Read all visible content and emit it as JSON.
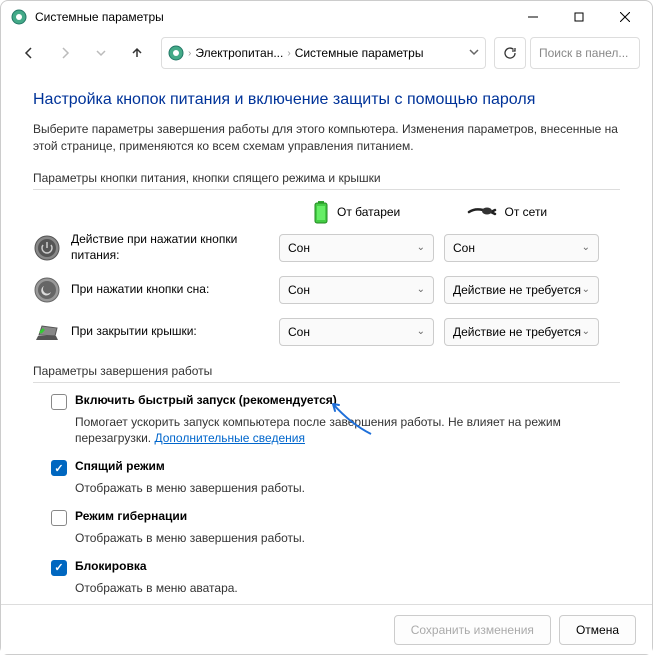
{
  "window": {
    "title": "Системные параметры"
  },
  "breadcrumb": {
    "item1": "Электропитан...",
    "item2": "Системные параметры"
  },
  "search": {
    "placeholder": "Поиск в панел..."
  },
  "heading": "Настройка кнопок питания и включение защиты с помощью пароля",
  "description": "Выберите параметры завершения работы для этого компьютера. Изменения параметров, внесенные на этой странице, применяются ко всем схемам управления питанием.",
  "section1_label": "Параметры кнопки питания, кнопки спящего режима и крышки",
  "columns": {
    "battery": "От батареи",
    "plugged": "От сети"
  },
  "rows": {
    "power_button": {
      "label": "Действие при нажатии кнопки питания:",
      "battery": "Сон",
      "plugged": "Сон"
    },
    "sleep_button": {
      "label": "При нажатии кнопки сна:",
      "battery": "Сон",
      "plugged": "Действие не требуется"
    },
    "lid": {
      "label": "При закрытии крышки:",
      "battery": "Сон",
      "plugged": "Действие не требуется"
    }
  },
  "section2_label": "Параметры завершения работы",
  "checks": {
    "fast_startup": {
      "label": "Включить быстрый запуск (рекомендуется)",
      "desc_prefix": "Помогает ускорить запуск компьютера после завершения работы. Не влияет на режим перезагрузки. ",
      "link": "Дополнительные сведения"
    },
    "sleep": {
      "label": "Спящий режим",
      "desc": "Отображать в меню завершения работы."
    },
    "hibernate": {
      "label": "Режим гибернации",
      "desc": "Отображать в меню завершения работы."
    },
    "lock": {
      "label": "Блокировка",
      "desc": "Отображать в меню аватара."
    }
  },
  "buttons": {
    "save": "Сохранить изменения",
    "cancel": "Отмена"
  }
}
